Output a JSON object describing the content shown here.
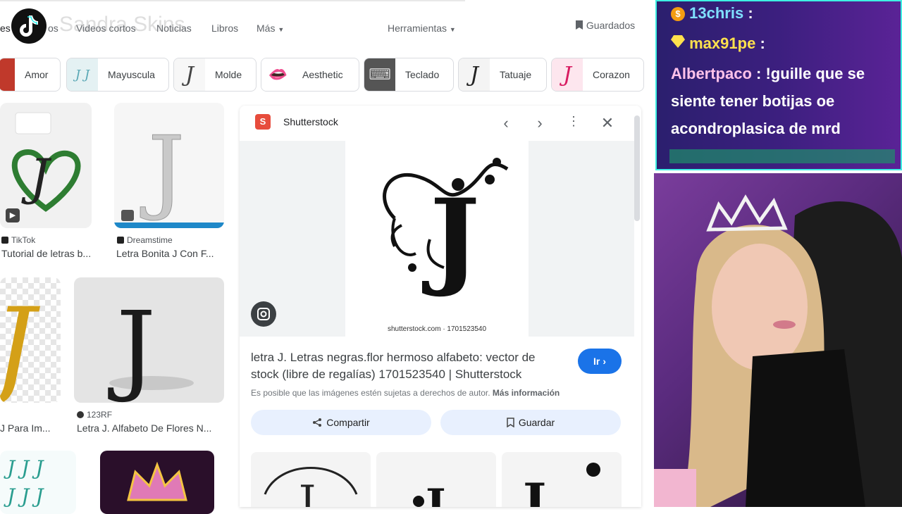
{
  "nav": {
    "tabs": [
      "es",
      "os",
      "Videos cortos",
      "Noticias",
      "Libros",
      "Más"
    ],
    "tools": "Herramientas",
    "saved": "Guardados",
    "watermark": "Sandra Skins"
  },
  "chips": [
    {
      "label": "Amor"
    },
    {
      "label": "Mayuscula"
    },
    {
      "label": "Molde"
    },
    {
      "label": "Aesthetic"
    },
    {
      "label": "Teclado"
    },
    {
      "label": "Tatuaje"
    },
    {
      "label": "Corazon"
    }
  ],
  "results": [
    {
      "source": "TikTok",
      "title": "Tutorial de letras b..."
    },
    {
      "source": "Dreamstime",
      "title": "Letra Bonita J Con F..."
    },
    {
      "source": "",
      "title": "J Para Im..."
    },
    {
      "source": "123RF",
      "title": "Letra J. Alfabeto De Flores N..."
    }
  ],
  "panel": {
    "site": "Shutterstock",
    "image_caption": "shutterstock.com · 1701523540",
    "title_line1": "letra J. Letras negras.flor hermoso alfabeto: vector de",
    "title_line2": "stock (libre de regalías) 1701523540 | Shutterstock",
    "notice": "Es posible que las imágenes estén sujetas a derechos de autor.",
    "more_info": "Más información",
    "visit": "Ir",
    "share": "Compartir",
    "save": "Guardar"
  },
  "chat": {
    "messages": [
      {
        "user": "13chris",
        "text": ":",
        "color": "#7fe0ff"
      },
      {
        "user": "max91pe",
        "text": ":",
        "color": "#ffe14d"
      },
      {
        "user": "Albertpaco",
        "text": ": !guille que se",
        "color": "#ffc2ea"
      }
    ],
    "continuation": [
      "siente tener botijas oe",
      "acondroplasica de mrd"
    ]
  },
  "colors": {
    "accent": "#1a73e8",
    "chat_border": "#3ef0e3"
  }
}
